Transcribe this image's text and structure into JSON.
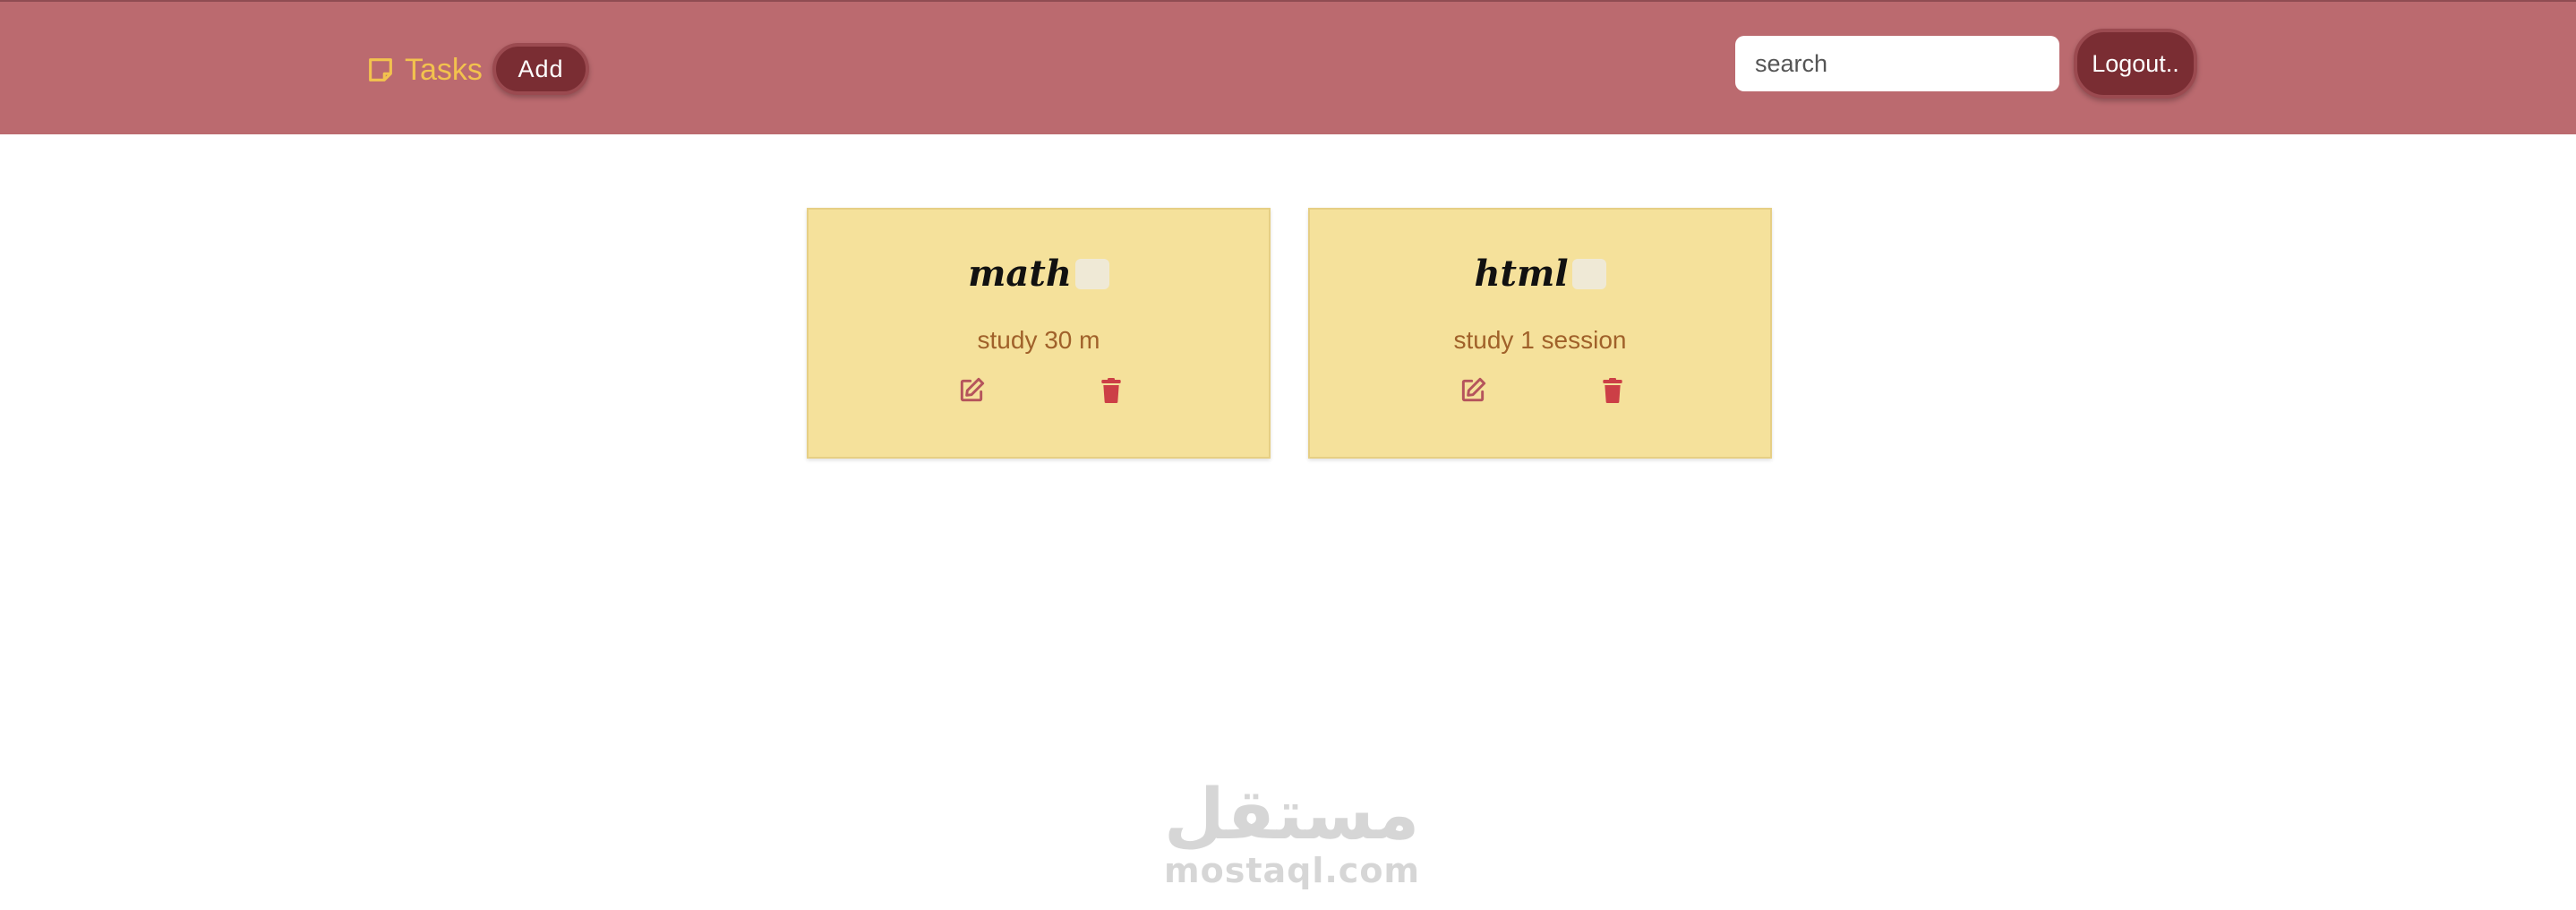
{
  "navbar": {
    "brand_label": "Tasks",
    "add_label": "Add",
    "search_placeholder": "search",
    "logout_label": "Logout.."
  },
  "tasks": [
    {
      "title": "math",
      "description": "study 30 m"
    },
    {
      "title": "html",
      "description": "study 1 session"
    }
  ],
  "watermark": {
    "arabic": "مستقل",
    "latin": "mostaql.com"
  },
  "colors": {
    "navbar_bg": "#bb6a6f",
    "brand": "#f2c24e",
    "button_bg": "#7a2d33",
    "card_bg": "#f5e19b",
    "description": "#a0612a",
    "edit_icon": "#b5545c",
    "trash_icon": "#cc3f46"
  },
  "icons": {
    "brand": "sticky-note-icon",
    "edit": "edit-icon",
    "delete": "trash-icon"
  }
}
